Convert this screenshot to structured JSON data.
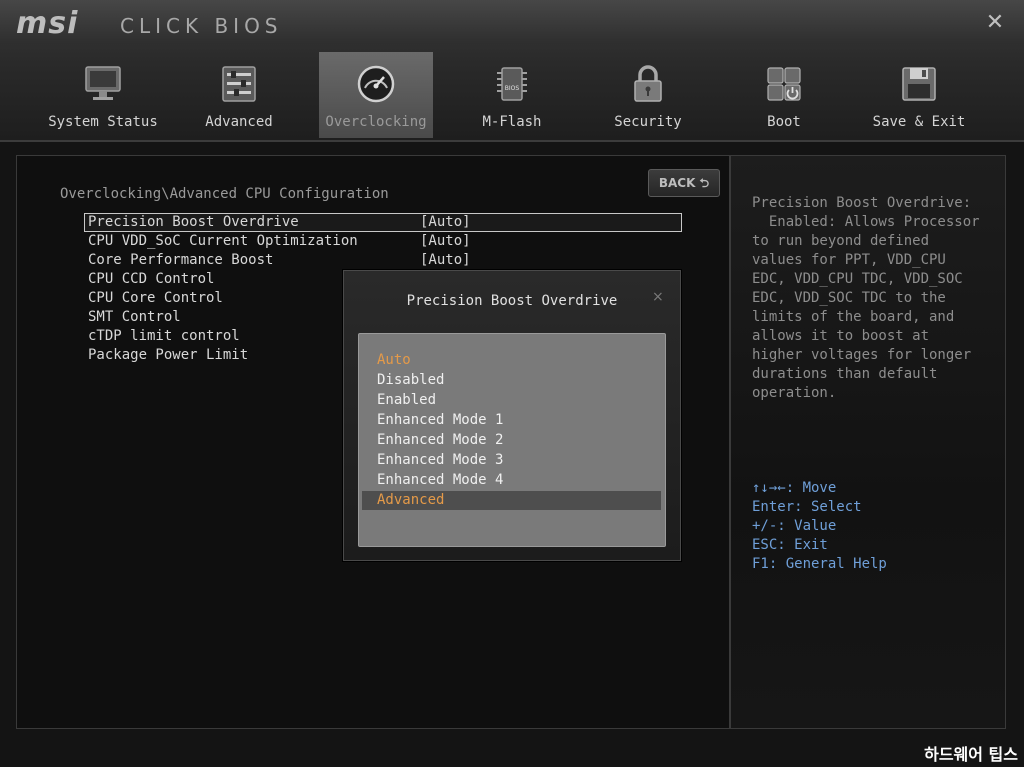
{
  "header": {
    "logo": "msi",
    "subtitle": "CLICK BIOS",
    "close_icon": "close-icon"
  },
  "tabs": [
    {
      "label": "System Status",
      "icon": "monitor-icon",
      "active": false
    },
    {
      "label": "Advanced",
      "icon": "sliders-icon",
      "active": false
    },
    {
      "label": "Overclocking",
      "icon": "gauge-icon",
      "active": true
    },
    {
      "label": "M-Flash",
      "icon": "bios-chip-icon",
      "active": false
    },
    {
      "label": "Security",
      "icon": "lock-icon",
      "active": false
    },
    {
      "label": "Boot",
      "icon": "power-keys-icon",
      "active": false
    },
    {
      "label": "Save & Exit",
      "icon": "floppy-icon",
      "active": false
    }
  ],
  "main": {
    "breadcrumb": "Overclocking\\Advanced CPU Configuration",
    "back_label": "BACK ⮌",
    "settings": [
      {
        "name": "Precision Boost Overdrive",
        "value": "[Auto]"
      },
      {
        "name": "CPU VDD_SoC Current Optimization",
        "value": "[Auto]"
      },
      {
        "name": "Core Performance Boost",
        "value": "[Auto]"
      },
      {
        "name": "CPU CCD Control",
        "value": ""
      },
      {
        "name": "CPU Core Control",
        "value": ""
      },
      {
        "name": "SMT Control",
        "value": ""
      },
      {
        "name": "cTDP limit control",
        "value": ""
      },
      {
        "name": "Package Power Limit",
        "value": ""
      }
    ]
  },
  "popup": {
    "title": "Precision Boost Overdrive",
    "close": "×",
    "options": [
      "Auto",
      "Disabled",
      "Enabled",
      "Enhanced Mode 1",
      "Enhanced Mode 2",
      "Enhanced Mode 3",
      "Enhanced Mode 4",
      "Advanced"
    ]
  },
  "help": {
    "text": "Precision Boost Overdrive:\n  Enabled: Allows Processor\nto run beyond defined\nvalues for PPT, VDD_CPU\nEDC, VDD_CPU TDC, VDD_SOC\nEDC, VDD_SOC TDC to the\nlimits of the board, and\nallows it to boost at\nhigher voltages for longer\ndurations than default\noperation.",
    "keys": "↑↓→←: Move\nEnter: Select\n+/-: Value\nESC: Exit\nF1: General Help"
  },
  "watermark": "하드웨어 팁스",
  "colors": {
    "accent_orange": "#e49a49",
    "key_blue": "#6f9fd8"
  }
}
